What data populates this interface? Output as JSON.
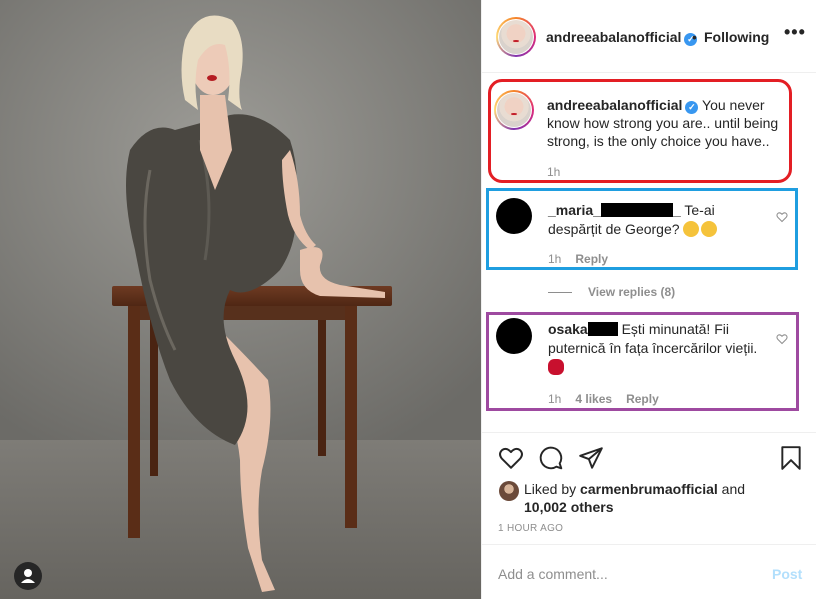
{
  "header": {
    "username": "andreeabalanofficial",
    "separator": "•",
    "follow_status": "Following",
    "more_icon": "more-horizontal-icon",
    "more_label": "•••"
  },
  "caption": {
    "username": "andreeabalanofficial",
    "text": "You never know how strong you are.. until being strong, is the only choice you have..",
    "time": "1h",
    "highlight_color": "#e31e24"
  },
  "comments": [
    {
      "username_prefix": "_maria_",
      "username_suffix": "_",
      "text": "Te-ai despărțit de George?",
      "time": "1h",
      "reply_label": "Reply",
      "highlight_color": "#1f9ee0"
    },
    {
      "username_prefix": "osaka",
      "text": "Ești minunată! Fii puternică în fața încercărilor vieții.",
      "time": "1h",
      "likes": "4 likes",
      "reply_label": "Reply",
      "highlight_color": "#9e4aa0"
    }
  ],
  "view_replies": "View replies (8)",
  "likes": {
    "prefix": "Liked by",
    "user": "carmenbrumaofficial",
    "and": "and",
    "others": "10,002 others"
  },
  "posted": "1 HOUR AGO",
  "add_comment": {
    "placeholder": "Add a comment...",
    "post_label": "Post"
  },
  "icons": [
    "heart-icon",
    "comment-icon",
    "share-icon",
    "bookmark-icon",
    "user-icon",
    "verified-icon"
  ]
}
